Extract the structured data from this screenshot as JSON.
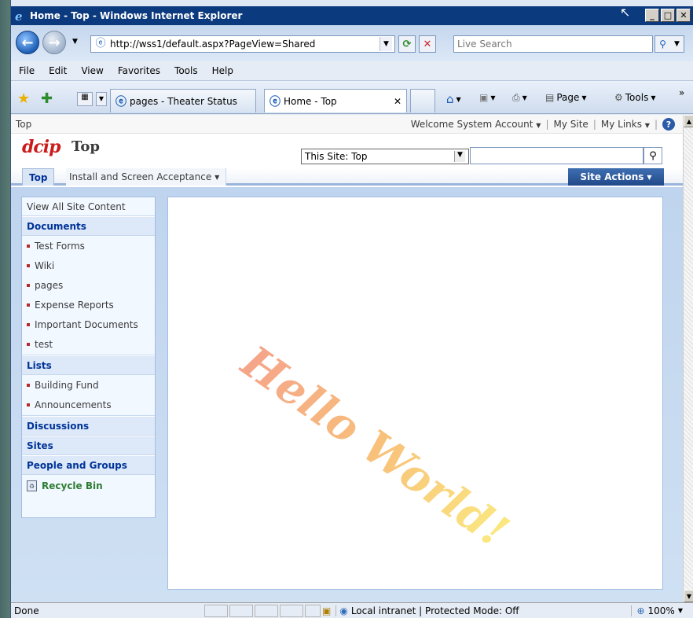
{
  "window": {
    "title": "Home - Top - Windows Internet Explorer"
  },
  "address": {
    "url": "http://wss1/default.aspx?PageView=Shared",
    "search_placeholder": "Live Search"
  },
  "menu": [
    "File",
    "Edit",
    "View",
    "Favorites",
    "Tools",
    "Help"
  ],
  "tabs": [
    {
      "label": "pages - Theater Status"
    },
    {
      "label": "Home - Top"
    }
  ],
  "commands": {
    "page": "Page",
    "tools": "Tools"
  },
  "sp": {
    "breadcrumb": "Top",
    "welcome": "Welcome System Account",
    "my_site": "My Site",
    "my_links": "My Links",
    "logo": "dcip",
    "site_title": "Top",
    "scope": "This Site: Top",
    "nav_top": "Top",
    "nav_install": "Install and Screen Acceptance",
    "site_actions": "Site Actions",
    "quicklaunch": {
      "view_all": "View All Site Content",
      "documents": "Documents",
      "documents_items": [
        "Test Forms",
        "Wiki",
        "pages",
        "Expense Reports",
        "Important Documents",
        "test"
      ],
      "lists": "Lists",
      "lists_items": [
        "Building Fund",
        "Announcements"
      ],
      "discussions": "Discussions",
      "sites": "Sites",
      "people": "People and Groups",
      "recycle": "Recycle Bin"
    },
    "content_text": "Hello World!"
  },
  "status": {
    "done": "Done",
    "zone": "Local intranet | Protected Mode: Off",
    "zoom": "100%"
  }
}
